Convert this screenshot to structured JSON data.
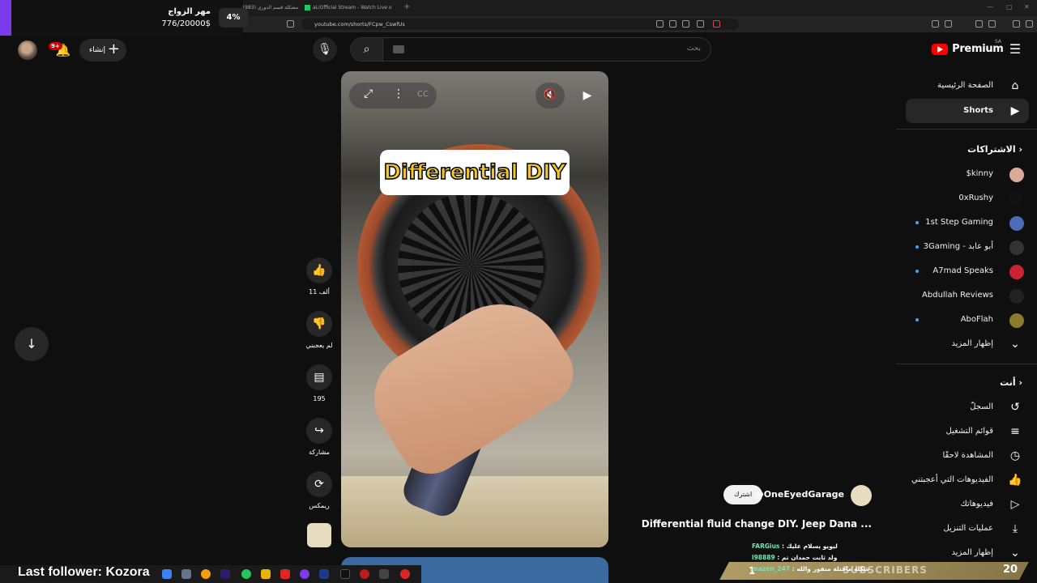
{
  "browser": {
    "tabs": [
      {
        "label": "(1983) مشكلة قسم الدوري"
      },
      {
        "label": "aLiOfficial Stream - Watch Live o"
      }
    ],
    "url": "youtube.com/shorts/FCpw_CswfUs"
  },
  "donation_widget": {
    "title": "مهر الزواج",
    "amount": "776/20000$",
    "percent": "4%",
    "percent_value": 0.0388
  },
  "header": {
    "notification_count": "9+",
    "create_label": "إنشاء",
    "search_placeholder": "بحث",
    "logo_word": "Premium",
    "country_code": "SA"
  },
  "sidebar": {
    "main": [
      {
        "label": "الصفحة الرئيسية",
        "icon": "home-icon"
      },
      {
        "label": "Shorts",
        "icon": "shorts-icon"
      }
    ],
    "subscriptions_heading": "الاشتراكات",
    "subscriptions": [
      {
        "label": "$kinny",
        "dot": false,
        "color": "#d9a99b"
      },
      {
        "label": "0xRushy",
        "dot": false,
        "color": "#111111"
      },
      {
        "label": "1st Step Gaming",
        "dot": true,
        "color": "#4b6cb7"
      },
      {
        "label": "3Gaming - أبو عابد",
        "dot": true,
        "color": "#333333"
      },
      {
        "label": "A7mad Speaks",
        "dot": true,
        "color": "#cc2233"
      },
      {
        "label": "Abdullah Reviews",
        "dot": false,
        "color": "#222222"
      },
      {
        "label": "AboFlah",
        "dot": true,
        "color": "#8a7a2a"
      }
    ],
    "show_more_1": "إظهار المزيد",
    "you_heading": "أنت",
    "you_items": [
      {
        "label": "السجلّ",
        "icon": "history-icon"
      },
      {
        "label": "قوائم التشغيل",
        "icon": "playlists-icon"
      },
      {
        "label": "المشاهدة لاحقًا",
        "icon": "watch-later-icon"
      },
      {
        "label": "الفيديوهات التي أعجبتني",
        "icon": "liked-icon"
      },
      {
        "label": "فيديوهاتك",
        "icon": "your-videos-icon"
      },
      {
        "label": "عمليات التنزيل",
        "icon": "downloads-icon"
      }
    ],
    "show_more_2": "إظهار المزيد"
  },
  "short": {
    "overlay_title": "Differential DIY",
    "channel_handle": "@OneEyedGarage",
    "subscribe_label": "اشترك",
    "description": "Differential fluid change DIY. Jeep Dana ..."
  },
  "actions": {
    "like_count": "11 ألف",
    "dislike_label": "لم يعجبني",
    "comment_count": "195",
    "share_label": "مشاركة",
    "remix_label": "ريمكس"
  },
  "stream_overlay": {
    "chat": [
      {
        "name": "FARGius",
        "message": "ليويو يسلام عليك"
      },
      {
        "name": "l98889",
        "message": "ولد ثابت حمدان تم"
      },
      {
        "name": "mazen_247",
        "message": "شكله ماقتلة منفور والله"
      }
    ],
    "banner_label": "SUBSCRIBERS",
    "banner_count": "20",
    "banner_sub_count": "1",
    "last_follower": "Last follower: Kozora"
  }
}
